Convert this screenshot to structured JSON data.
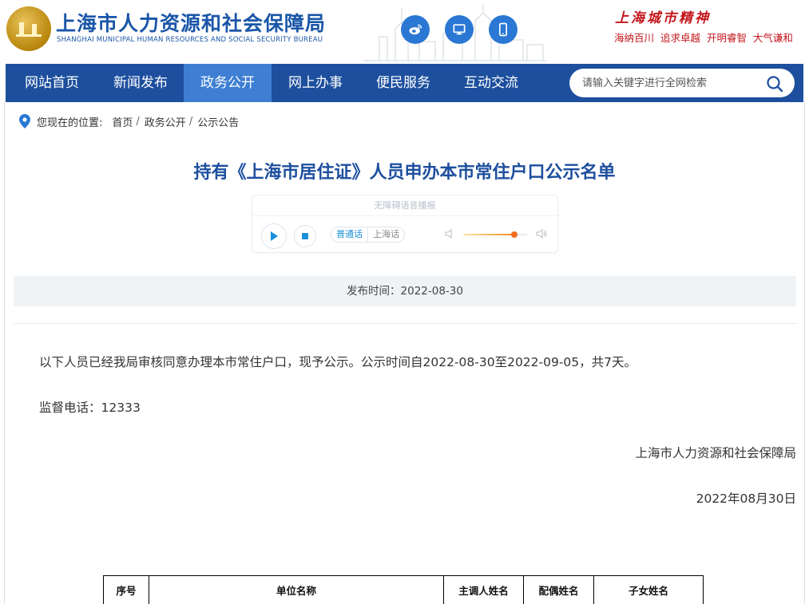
{
  "header": {
    "title": "上海市人力资源和社会保障局",
    "subtitle": "SHANGHAI MUNICIPAL HUMAN RESOURCES AND SOCIAL SECURITY BUREAU",
    "sns_icons": [
      "weibo-icon",
      "monitor-icon",
      "mobile-icon"
    ],
    "spirit_title": "上海城市精神",
    "spirit_words": "海纳百川  追求卓越  开明睿智  大气谦和"
  },
  "nav": {
    "items": [
      {
        "label": "网站首页"
      },
      {
        "label": "新闻发布"
      },
      {
        "label": "政务公开"
      },
      {
        "label": "网上办事"
      },
      {
        "label": "便民服务"
      },
      {
        "label": "互动交流"
      }
    ],
    "active_index": 2,
    "search_placeholder": "请输入关键字进行全网检索"
  },
  "breadcrumb": {
    "label": "您现在的位置:",
    "items": [
      "首页",
      "政务公开",
      "公示公告"
    ]
  },
  "article": {
    "title": "持有《上海市居住证》人员申办本市常住户口公示名单",
    "player": {
      "title": "无障碍语音播报",
      "lang_mandarin": "普通话",
      "lang_shanghainese": "上海话",
      "volume": 0.8
    },
    "meta": "发布时间：2022-08-30",
    "body": "以下人员已经我局审核同意办理本市常住户口，现予公示。公示时间自2022-08-30至2022-09-05，共7天。",
    "phone": "监督电话：12333",
    "signature": "上海市人力资源和社会保障局",
    "date": "2022年08月30日"
  },
  "table": {
    "headers": [
      "序号",
      "单位名称",
      "主调人姓名",
      "配偶姓名",
      "子女姓名"
    ]
  },
  "colors": {
    "brand_blue": "#1d4f9e",
    "nav_active": "#3e7fd3",
    "spirit_red": "#c3161c",
    "sns_blue": "#2a78d4"
  }
}
